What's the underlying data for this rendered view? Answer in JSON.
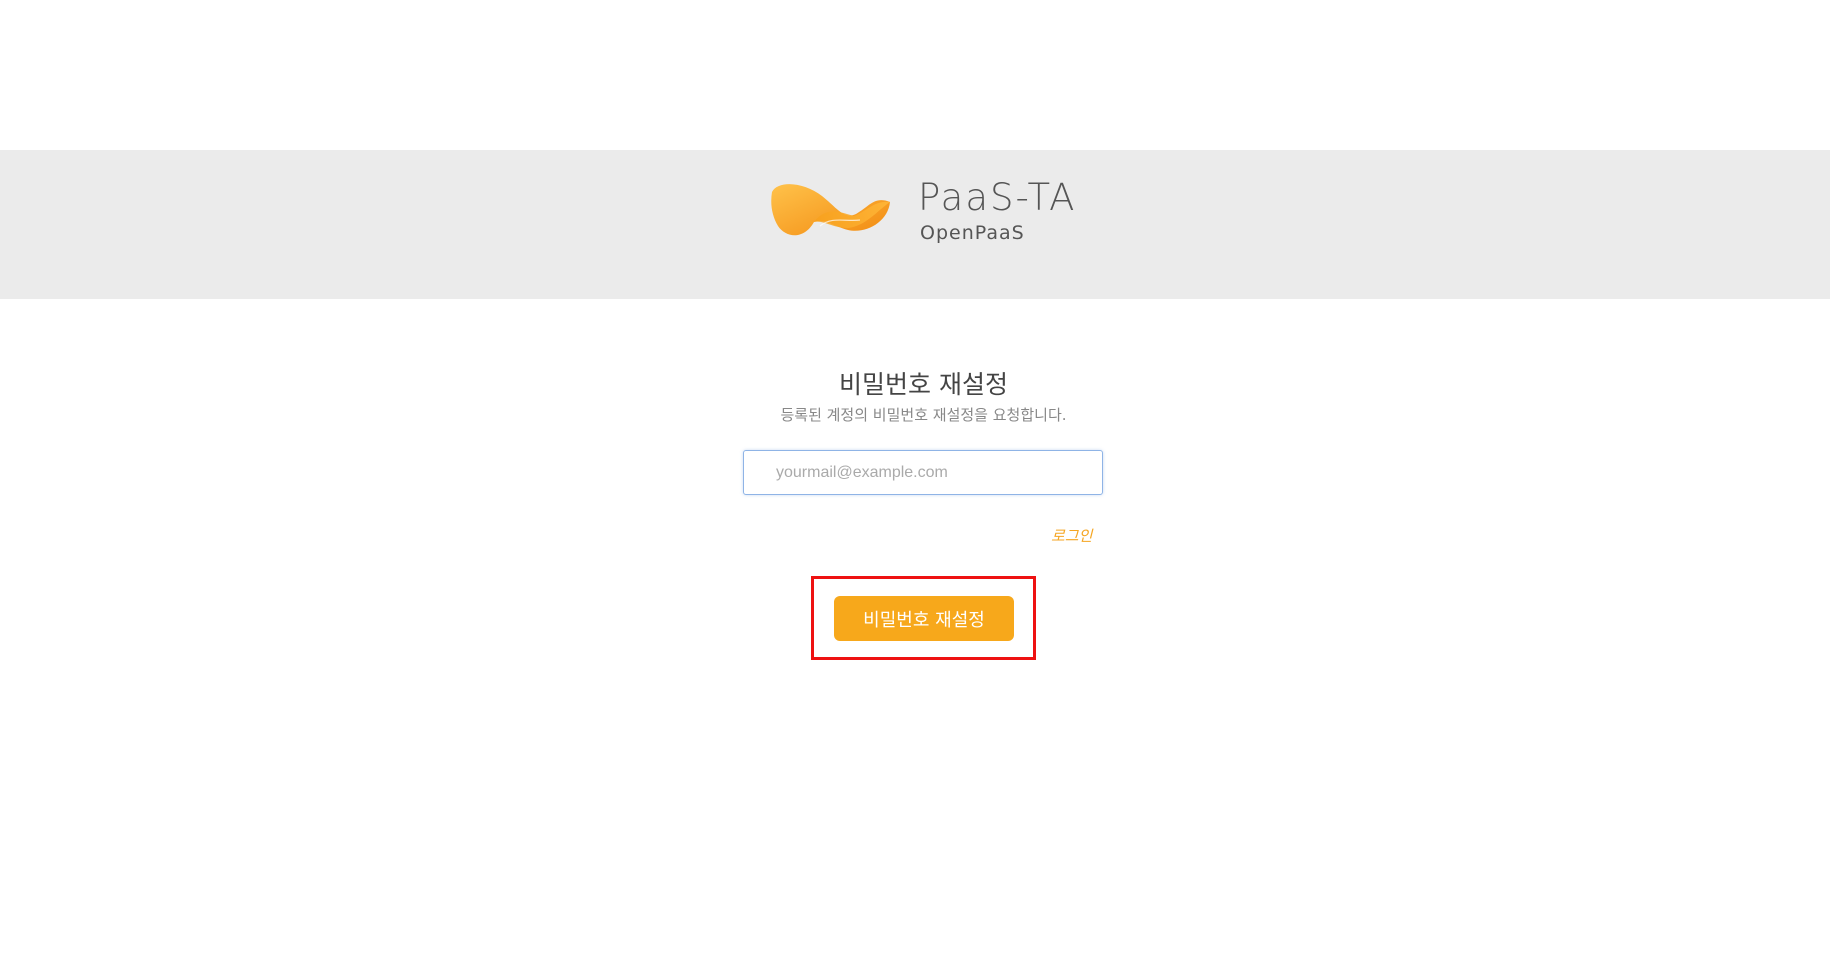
{
  "brand": {
    "logo_title": "PaaS-TA",
    "logo_subtitle": "OpenPaaS",
    "logo_icon": "orange-swirl-icon",
    "colors": {
      "accent": "#f7a81b",
      "header_band": "#ebebeb",
      "highlight": "#ee1111"
    }
  },
  "form": {
    "title": "비밀번호 재설정",
    "description": "등록된 계정의 비밀번호 재설정을 요청합니다.",
    "email": {
      "value": "",
      "placeholder": "yourmail@example.com"
    },
    "login_link": "로그인",
    "submit_label": "비밀번호 재설정"
  }
}
